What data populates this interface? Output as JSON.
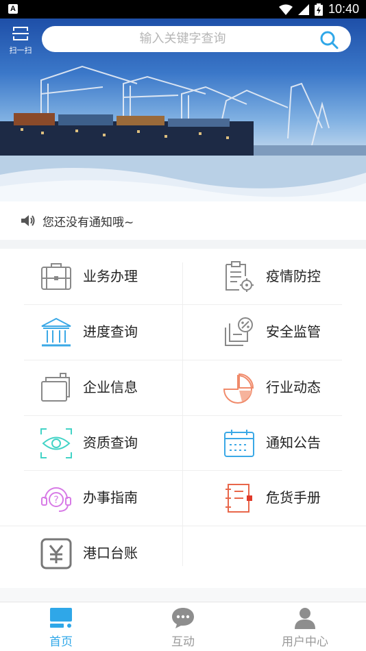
{
  "status_bar": {
    "time": "10:40",
    "app_badge": "A"
  },
  "header": {
    "scan_label": "扫一扫",
    "search_placeholder": "输入关键字查询"
  },
  "notice": {
    "text": "您还没有通知哦~"
  },
  "menu": [
    {
      "label": "业务办理",
      "icon": "briefcase-icon"
    },
    {
      "label": "疫情防控",
      "icon": "clipboard-gear-icon"
    },
    {
      "label": "进度查询",
      "icon": "bank-building-icon"
    },
    {
      "label": "安全监管",
      "icon": "percent-document-icon"
    },
    {
      "label": "企业信息",
      "icon": "folder-stack-icon"
    },
    {
      "label": "行业动态",
      "icon": "pie-chart-icon"
    },
    {
      "label": "资质查询",
      "icon": "eye-scan-icon"
    },
    {
      "label": "通知公告",
      "icon": "calendar-board-icon"
    },
    {
      "label": "办事指南",
      "icon": "headset-help-icon"
    },
    {
      "label": "危货手册",
      "icon": "manual-list-icon"
    },
    {
      "label": "港口台账",
      "icon": "yuan-ledger-icon"
    }
  ],
  "bottom_nav": [
    {
      "label": "首页",
      "icon": "home-screen-icon",
      "active": true
    },
    {
      "label": "互动",
      "icon": "chat-bubble-icon",
      "active": false
    },
    {
      "label": "用户中心",
      "icon": "user-icon",
      "active": false
    }
  ],
  "colors": {
    "accent": "#2fa7e8",
    "inactive": "#9a9a9a"
  }
}
